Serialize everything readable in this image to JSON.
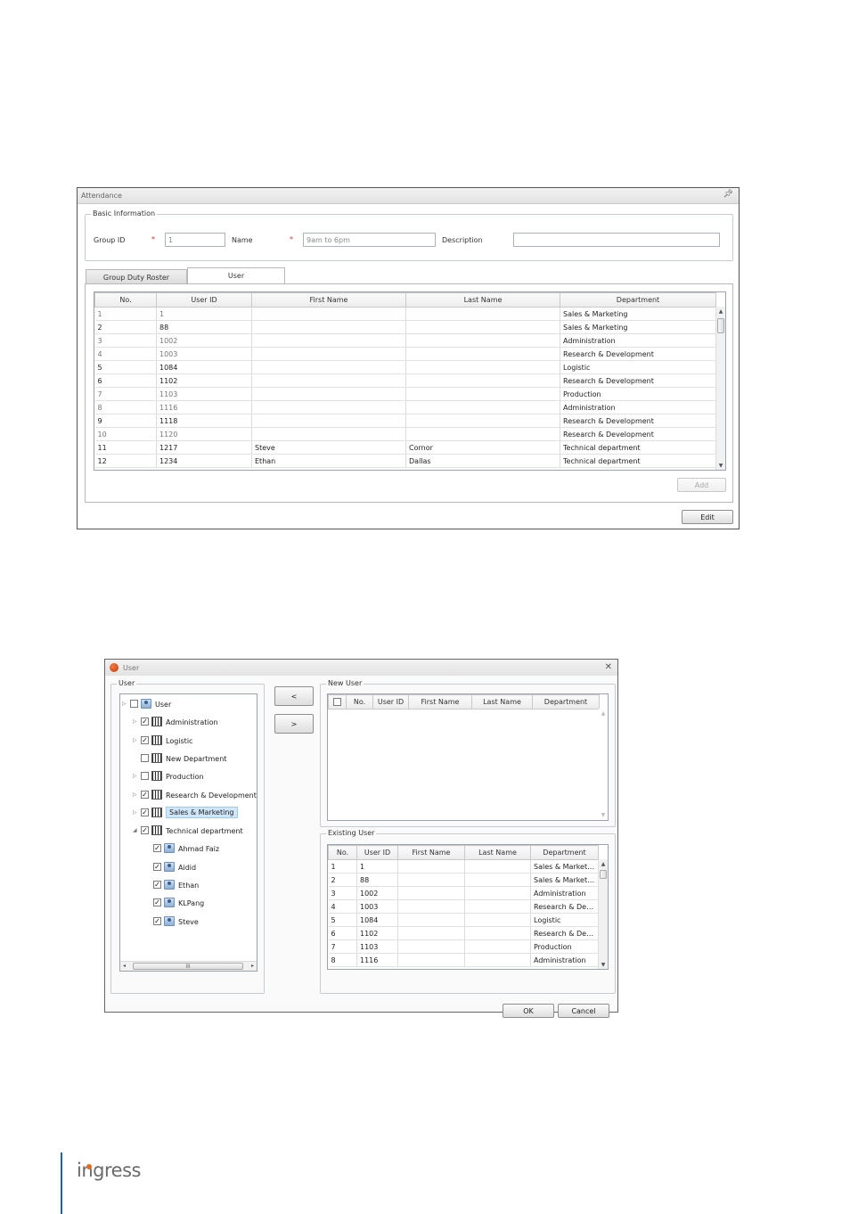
{
  "attendance": {
    "title": "Attendance",
    "pin_icon": "pin-icon",
    "basic_info": {
      "legend": "Basic Information",
      "group_id_label": "Group ID",
      "group_id_value": "1",
      "name_label": "Name",
      "name_value": "9am to 6pm",
      "description_label": "Description",
      "description_value": "",
      "required_mark": "*"
    },
    "tabs": [
      {
        "label": "Group Duty Roster",
        "active": false
      },
      {
        "label": "User",
        "active": true
      }
    ],
    "table": {
      "columns": [
        "No.",
        "User ID",
        "First Name",
        "Last Name",
        "Department"
      ],
      "rows": [
        {
          "no": "1",
          "id": "1",
          "first": "",
          "last": "",
          "dept": "Sales & Marketing"
        },
        {
          "no": "2",
          "id": "88",
          "first": "",
          "last": "",
          "dept": "Sales & Marketing"
        },
        {
          "no": "3",
          "id": "1002",
          "first": "",
          "last": "",
          "dept": "Administration"
        },
        {
          "no": "4",
          "id": "1003",
          "first": "",
          "last": "",
          "dept": "Research & Development"
        },
        {
          "no": "5",
          "id": "1084",
          "first": "",
          "last": "",
          "dept": "Logistic"
        },
        {
          "no": "6",
          "id": "1102",
          "first": "",
          "last": "",
          "dept": "Research & Development"
        },
        {
          "no": "7",
          "id": "1103",
          "first": "",
          "last": "",
          "dept": "Production"
        },
        {
          "no": "8",
          "id": "1116",
          "first": "",
          "last": "",
          "dept": "Administration"
        },
        {
          "no": "9",
          "id": "1118",
          "first": "",
          "last": "",
          "dept": "Research & Development"
        },
        {
          "no": "10",
          "id": "1120",
          "first": "",
          "last": "",
          "dept": "Research & Development"
        },
        {
          "no": "11",
          "id": "1217",
          "first": "Steve",
          "last": "Cornor",
          "dept": "Technical department"
        },
        {
          "no": "12",
          "id": "1234",
          "first": "Ethan",
          "last": "Dallas",
          "dept": "Technical department"
        }
      ]
    },
    "add_label": "Add",
    "edit_label": "Edit"
  },
  "user_dialog": {
    "title": "User",
    "close_icon": "close-icon",
    "user_group_legend": "User",
    "tree": [
      {
        "label": "User",
        "level": 0,
        "checked": false,
        "icon": "user-icon",
        "expander": "▷"
      },
      {
        "label": "Administration",
        "level": 1,
        "checked": true,
        "icon": "department-icon",
        "expander": "▷"
      },
      {
        "label": "Logistic",
        "level": 1,
        "checked": true,
        "icon": "department-icon",
        "expander": "▷"
      },
      {
        "label": "New Department",
        "level": 1,
        "checked": false,
        "icon": "department-icon",
        "expander": ""
      },
      {
        "label": "Production",
        "level": 1,
        "checked": false,
        "icon": "department-icon",
        "expander": "▷"
      },
      {
        "label": "Research & Development",
        "level": 1,
        "checked": true,
        "icon": "department-icon",
        "expander": "▷"
      },
      {
        "label": "Sales & Marketing",
        "level": 1,
        "checked": true,
        "icon": "department-icon",
        "expander": "▷",
        "selected": true
      },
      {
        "label": "Technical department",
        "level": 1,
        "checked": true,
        "icon": "department-icon",
        "expander": "◢"
      },
      {
        "label": "Ahmad Faiz",
        "level": 2,
        "checked": true,
        "icon": "user-icon",
        "expander": ""
      },
      {
        "label": "Aidid",
        "level": 2,
        "checked": true,
        "icon": "user-icon",
        "expander": ""
      },
      {
        "label": "Ethan",
        "level": 2,
        "checked": true,
        "icon": "user-icon",
        "expander": ""
      },
      {
        "label": "KLPang",
        "level": 2,
        "checked": true,
        "icon": "user-icon",
        "expander": ""
      },
      {
        "label": "Steve",
        "level": 2,
        "checked": true,
        "icon": "user-icon",
        "expander": ""
      }
    ],
    "move_left_label": "<",
    "move_right_label": ">",
    "new_user": {
      "legend": "New User",
      "columns": [
        "No.",
        "User ID",
        "First Name",
        "Last Name",
        "Department"
      ]
    },
    "existing_user": {
      "legend": "Existing User",
      "columns": [
        "No.",
        "User ID",
        "First Name",
        "Last Name",
        "Department"
      ],
      "rows": [
        {
          "no": "1",
          "id": "1",
          "first": "",
          "last": "",
          "dept": "Sales & Marketi..."
        },
        {
          "no": "2",
          "id": "88",
          "first": "",
          "last": "",
          "dept": "Sales & Marketi..."
        },
        {
          "no": "3",
          "id": "1002",
          "first": "",
          "last": "",
          "dept": "Administration"
        },
        {
          "no": "4",
          "id": "1003",
          "first": "",
          "last": "",
          "dept": "Research & Dev..."
        },
        {
          "no": "5",
          "id": "1084",
          "first": "",
          "last": "",
          "dept": "Logistic"
        },
        {
          "no": "6",
          "id": "1102",
          "first": "",
          "last": "",
          "dept": "Research & Dev..."
        },
        {
          "no": "7",
          "id": "1103",
          "first": "",
          "last": "",
          "dept": "Production"
        },
        {
          "no": "8",
          "id": "1116",
          "first": "",
          "last": "",
          "dept": "Administration"
        }
      ]
    },
    "ok_label": "OK",
    "cancel_label": "Cancel"
  },
  "footer": {
    "logo_text": "ingress",
    "accent_color": "#1f5fb0",
    "logo_dot_color": "#e26a23"
  }
}
